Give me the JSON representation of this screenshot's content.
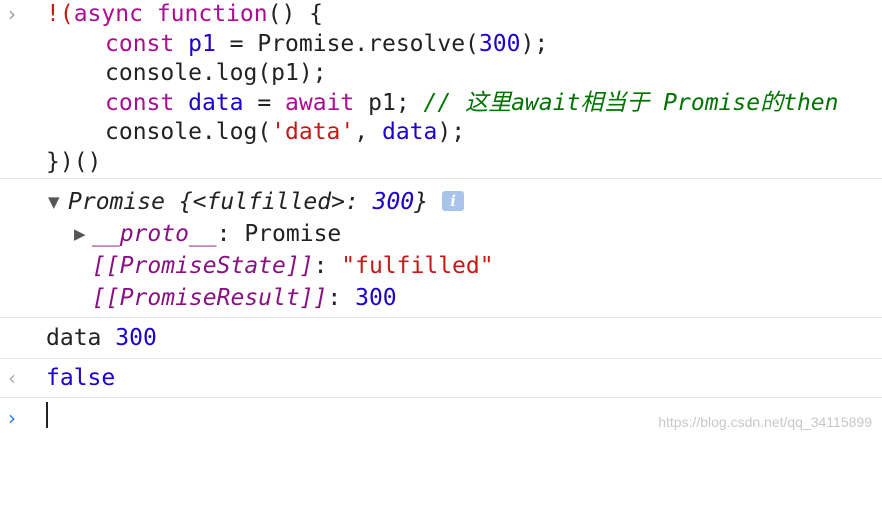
{
  "console": {
    "input_prompt": "›",
    "result_prompt": "‹",
    "code_lines": {
      "l1_bang": "!(",
      "l1_async": "async",
      "l1_function": "function",
      "l1_rest": "() {",
      "l2_const": "const",
      "l2_p1": "p1",
      "l2_eq": " = Promise.resolve(",
      "l2_num": "300",
      "l2_end": ");",
      "l3_text": "console.log(p1);",
      "l4_const": "const",
      "l4_data": "data",
      "l4_eq": " = ",
      "l4_await": "await",
      "l4_p1": " p1;",
      "l4_comment": "// 这里await相当于 Promise的then",
      "l5_pre": "console.log(",
      "l5_str": "'data'",
      "l5_mid": ", ",
      "l5_data": "data",
      "l5_end": ");",
      "l6_text": "})()"
    },
    "promise_output": {
      "summary_type": "Promise",
      "summary_open": " {",
      "summary_state_key": "<fulfilled>",
      "summary_colon": ": ",
      "summary_value": "300",
      "summary_close": "}",
      "info_badge": "i",
      "proto_key": "__proto__",
      "proto_value": "Promise",
      "state_key": "[[PromiseState]]",
      "state_value": "\"fulfilled\"",
      "result_key": "[[PromiseResult]]",
      "result_value": "300"
    },
    "log_output": {
      "label": "data",
      "value": "300"
    },
    "return_value": "false"
  },
  "watermark": "https://blog.csdn.net/qq_34115899",
  "colors": {
    "keyword": "#aa0d91",
    "identifier": "#1c00cf",
    "string": "#c41a16",
    "comment": "#007400",
    "property": "#881280"
  }
}
